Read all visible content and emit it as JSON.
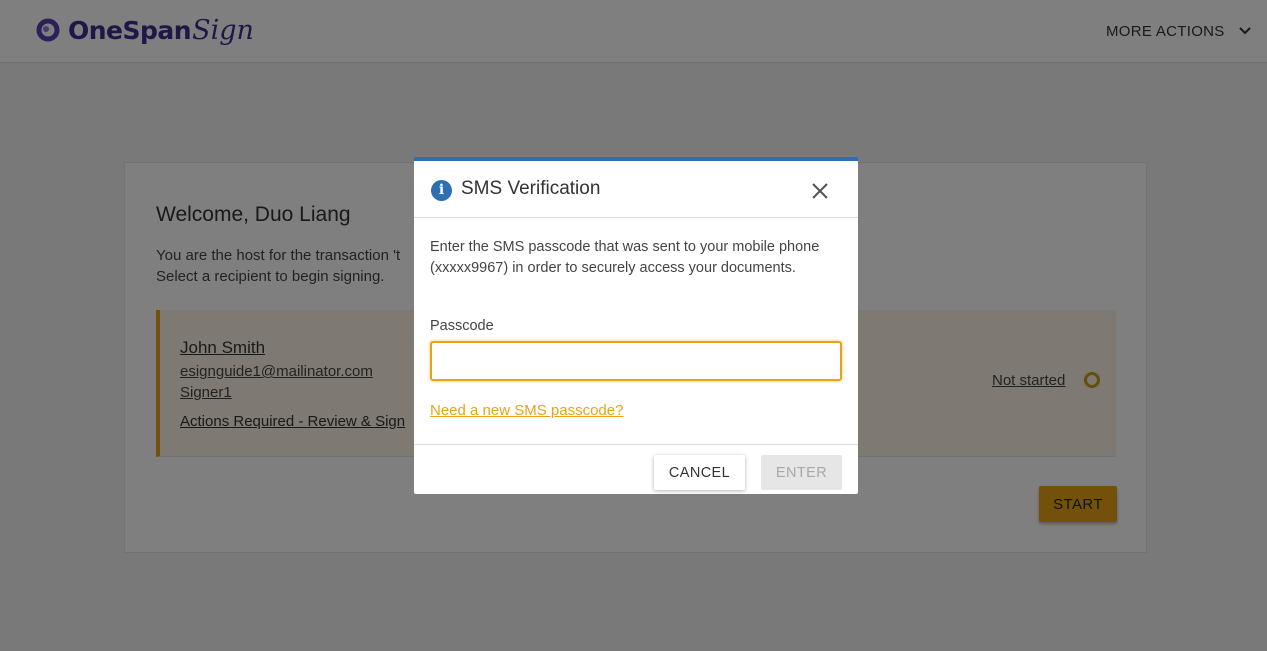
{
  "header": {
    "brand": "OneSpan",
    "brand_script": "Sign",
    "more_actions_label": "MORE ACTIONS"
  },
  "main": {
    "welcome": "Welcome, Duo Liang",
    "host_line": "You are the host for the transaction 't",
    "select_line": "Select a recipient to begin signing.",
    "recipient": {
      "name": "John Smith",
      "email": "esignguide1@mailinator.com",
      "role": "Signer1",
      "actions": "Actions Required - Review & Sign",
      "status": "Not started"
    },
    "start_label": "START"
  },
  "modal": {
    "title": "SMS Verification",
    "body": "Enter the SMS passcode that was sent to your mobile phone (xxxxx9967) in order to securely access your documents.",
    "passcode_label": "Passcode",
    "passcode_value": "",
    "new_passcode_link": "Need a new SMS passcode?",
    "cancel_label": "CANCEL",
    "enter_label": "ENTER"
  },
  "colors": {
    "accent": "#e8a317",
    "modal_top": "#2e6fb3",
    "brand": "#3d2e8f"
  }
}
